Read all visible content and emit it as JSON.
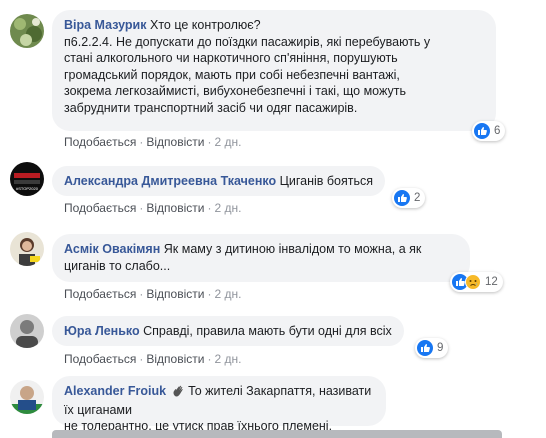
{
  "comments": [
    {
      "author": "Віра Мазурик",
      "text": "Хто це контролює?",
      "lines": [
        "п6.2.2.4. Не допускати до поїздки пасажирів, які перебувають у",
        "стані алкогольного чи наркотичного сп'яніння, порушують",
        "громадський порядок, мають при собі небезпечні вантажі,",
        "зокрема легкозаймисті, вибухонебезпечні і такі, що можуть",
        "забруднити транспортний засіб чи одяг пасажирів."
      ],
      "like_label": "Подобається",
      "reply_label": "Відповісти",
      "time": "2 дн.",
      "reaction_count": "6"
    },
    {
      "author": "Александра Дмитреевна Ткаченко",
      "text": "Циганів бояться",
      "avatar_caption": "#STOP2020",
      "like_label": "Подобається",
      "reply_label": "Відповісти",
      "time": "2 дн.",
      "reaction_count": "2"
    },
    {
      "author": "Асмік Овакімян",
      "text": "Як маму з дитиною інвалідом то можна, а як",
      "text2": "циганів то слабо...",
      "like_label": "Подобається",
      "reply_label": "Відповісти",
      "time": "2 дн.",
      "reaction_count": "12"
    },
    {
      "author": "Юра Ленько",
      "text": "Справді, правила мають бути одні для всіх",
      "like_label": "Подобається",
      "reply_label": "Відповісти",
      "time": "2 дн.",
      "reaction_count": "9"
    },
    {
      "author": "Alexander Froiuk",
      "text": "То жителі Закарпаття, називати їх циганами",
      "text2": "не толерантно, це утиск прав їхнього племені."
    }
  ],
  "colors": {
    "author": "#385898",
    "bubble": "#f2f3f5",
    "like": "#1877f2",
    "sad": "#f7b928"
  },
  "icons": {
    "like": "like-icon",
    "sad": "sad-icon",
    "hand": "waving-hand-icon"
  }
}
